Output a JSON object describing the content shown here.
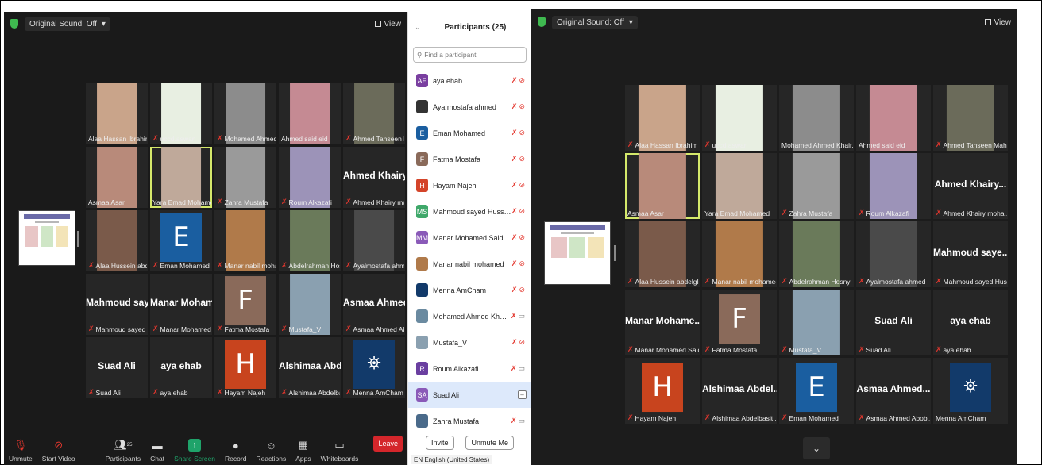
{
  "left": {
    "sound_label": "Original Sound: Off",
    "view_label": "View",
    "tiles": [
      {
        "name": "Alaa Hassan Ibrahim",
        "kind": "photo",
        "bg": "#c9a48a",
        "muted": false
      },
      {
        "name": "uccd.aswan",
        "kind": "photo",
        "bg": "#e8efe2",
        "muted": true
      },
      {
        "name": "Mohamed Ahmed Kh...",
        "kind": "photo",
        "bg": "#8c8c8c",
        "muted": true
      },
      {
        "name": "Ahmed said eid",
        "kind": "photo",
        "bg": "#c58a93",
        "muted": false
      },
      {
        "name": "Ahmed Tahseen Mah...",
        "kind": "photo",
        "bg": "#6b6b5a",
        "muted": true
      },
      {
        "name": "Asmaa Asar",
        "kind": "photo",
        "bg": "#b88a7a",
        "muted": false
      },
      {
        "name": "Yara Emad Mohamed",
        "kind": "photo",
        "bg": "#bfa99a",
        "muted": false,
        "active": true
      },
      {
        "name": "Zahra Mustafa",
        "kind": "photo",
        "bg": "#9a9a9a",
        "muted": true
      },
      {
        "name": "Roum Alkazafi",
        "kind": "photo",
        "bg": "#9c93b8",
        "muted": true
      },
      {
        "name": "Ahmed Khairy moha...",
        "kind": "text",
        "big": "Ahmed Khairy...",
        "muted": true
      },
      {
        "name": "Alaa Hussein abdelglil",
        "kind": "photo",
        "bg": "#7a5a4a",
        "muted": true
      },
      {
        "name": "Eman Mohamed",
        "kind": "letter",
        "letter": "E",
        "bg": "#1a5ea0",
        "muted": true
      },
      {
        "name": "Manar nabil mohamed",
        "kind": "photo",
        "bg": "#b07a4a",
        "muted": true
      },
      {
        "name": "Abdelrahman Hosny",
        "kind": "photo",
        "bg": "#6a7a5a",
        "muted": true
      },
      {
        "name": "Ayalmostafa ahmed",
        "kind": "photo",
        "bg": "#4a4a4a",
        "muted": true
      },
      {
        "name": "Mahmoud sayed Hus...",
        "kind": "text",
        "big": "Mahmoud saye...",
        "muted": true
      },
      {
        "name": "Manar Mohamed Said",
        "kind": "text",
        "big": "Manar Mohame...",
        "muted": true
      },
      {
        "name": "Fatma Mostafa",
        "kind": "letter",
        "letter": "F",
        "bg": "#8a6a5a",
        "muted": true
      },
      {
        "name": "Mustafa_V",
        "kind": "photo",
        "bg": "#8aa0b0",
        "muted": true
      },
      {
        "name": "Asmaa Ahmed Abob...",
        "kind": "text",
        "big": "Asmaa Ahmed...",
        "muted": true
      },
      {
        "name": "Suad Ali",
        "kind": "text",
        "big": "Suad Ali",
        "muted": true
      },
      {
        "name": "aya ehab",
        "kind": "text",
        "big": "aya ehab",
        "muted": true
      },
      {
        "name": "Hayam Najeh",
        "kind": "letter",
        "letter": "H",
        "bg": "#c8441e",
        "muted": true
      },
      {
        "name": "Alshimaa Abdelbasit ...",
        "kind": "text",
        "big": "Alshimaa Abdel...",
        "muted": true
      },
      {
        "name": "Menna AmCham",
        "kind": "logo",
        "bg": "#123a6a",
        "muted": true
      }
    ],
    "toolbar": {
      "unmute": "Unmute",
      "start_video": "Start Video",
      "participants": "Participants",
      "participants_count": "25",
      "chat": "Chat",
      "share": "Share Screen",
      "record": "Record",
      "reactions": "Reactions",
      "apps": "Apps",
      "whiteboards": "Whiteboards",
      "leave": "Leave"
    }
  },
  "panel": {
    "title": "Participants (25)",
    "search_placeholder": "Find a participant",
    "items": [
      {
        "name": "aya ehab",
        "avatar": "AE",
        "color": "#7a3fa0",
        "icons": "mic-off video-off"
      },
      {
        "name": "Aya mostafa ahmed",
        "avatar": "",
        "color": "#333333",
        "icons": "mic-off video-off"
      },
      {
        "name": "Eman Mohamed",
        "avatar": "E",
        "color": "#1a5ea0",
        "icons": "mic-off video-off"
      },
      {
        "name": "Fatma Mostafa",
        "avatar": "F",
        "color": "#8a6a5a",
        "icons": "mic-off video-off"
      },
      {
        "name": "Hayam Najeh",
        "avatar": "H",
        "color": "#d4442a",
        "icons": "mic-off video-off"
      },
      {
        "name": "Mahmoud sayed Hussein",
        "avatar": "MS",
        "color": "#3fa86a",
        "icons": "mic-off video-off"
      },
      {
        "name": "Manar Mohamed Said",
        "avatar": "MM",
        "color": "#8a5ab8",
        "icons": "mic-off video-off"
      },
      {
        "name": "Manar nabil mohamed",
        "avatar": "",
        "color": "#b07a4a",
        "icons": "mic-off video-off"
      },
      {
        "name": "Menna AmCham",
        "avatar": "",
        "color": "#123a6a",
        "icons": "mic-off video-off"
      },
      {
        "name": "Mohamed Ahmed Khairy Abdu...",
        "avatar": "",
        "color": "#6a8aa0",
        "icons": "mic-off video-on"
      },
      {
        "name": "Mustafa_V",
        "avatar": "",
        "color": "#8aa0b0",
        "icons": "mic-off video-off"
      },
      {
        "name": "Roum Alkazafi",
        "avatar": "R",
        "color": "#6a3fa0",
        "icons": "mic-off video-on"
      },
      {
        "name": "Suad Ali",
        "avatar": "SA",
        "color": "#8a5ab8",
        "icons": "host",
        "selected": true
      },
      {
        "name": "Zahra Mustafa",
        "avatar": "",
        "color": "#4a6a8a",
        "icons": "mic-off video-on"
      }
    ],
    "invite": "Invite",
    "unmute_me": "Unmute Me",
    "language": "EN English (United States)"
  },
  "right": {
    "sound_label": "Original Sound: Off",
    "view_label": "View",
    "tiles": [
      {
        "name": "Alaa Hassan Ibrahim",
        "kind": "photo",
        "bg": "#c9a48a",
        "muted": true
      },
      {
        "name": "uccd.aswan",
        "kind": "photo",
        "bg": "#e8efe2",
        "muted": true
      },
      {
        "name": "Mohamed Ahmed Khair...",
        "kind": "photo",
        "bg": "#8c8c8c",
        "muted": false
      },
      {
        "name": "Ahmed said eid",
        "kind": "photo",
        "bg": "#c58a93",
        "muted": false
      },
      {
        "name": "Ahmed Tahseen Mah...",
        "kind": "photo",
        "bg": "#6b6b5a",
        "muted": true
      },
      {
        "name": "Asmaa Asar",
        "kind": "photo",
        "bg": "#b88a7a",
        "muted": false,
        "active": true
      },
      {
        "name": "Yara Emad Mohamed",
        "kind": "photo",
        "bg": "#bfa99a",
        "muted": false
      },
      {
        "name": "Zahra Mustafa",
        "kind": "photo",
        "bg": "#9a9a9a",
        "muted": true
      },
      {
        "name": "Roum Alkazafi",
        "kind": "photo",
        "bg": "#9c93b8",
        "muted": true
      },
      {
        "name": "Ahmed Khairy moha...",
        "kind": "text",
        "big": "Ahmed Khairy...",
        "muted": true
      },
      {
        "name": "Alaa Hussein abdelglil",
        "kind": "photo",
        "bg": "#7a5a4a",
        "muted": true
      },
      {
        "name": "Manar nabil mohamed",
        "kind": "photo",
        "bg": "#b07a4a",
        "muted": true
      },
      {
        "name": "Abdelrahman Hosny",
        "kind": "photo",
        "bg": "#6a7a5a",
        "muted": true
      },
      {
        "name": "Ayalmostafa ahmed",
        "kind": "photo",
        "bg": "#4a4a4a",
        "muted": true
      },
      {
        "name": "Mahmoud sayed Hus...",
        "kind": "text",
        "big": "Mahmoud saye...",
        "muted": true
      },
      {
        "name": "Manar Mohamed Said",
        "kind": "text",
        "big": "Manar Mohame...",
        "muted": true
      },
      {
        "name": "Fatma Mostafa",
        "kind": "letter",
        "letter": "F",
        "bg": "#8a6a5a",
        "muted": true
      },
      {
        "name": "Mustafa_V",
        "kind": "photo",
        "bg": "#8aa0b0",
        "muted": true
      },
      {
        "name": "Suad Ali",
        "kind": "text",
        "big": "Suad Ali",
        "muted": true
      },
      {
        "name": "aya ehab",
        "kind": "text",
        "big": "aya ehab",
        "muted": true
      },
      {
        "name": "Hayam Najeh",
        "kind": "letter",
        "letter": "H",
        "bg": "#c8441e",
        "muted": true
      },
      {
        "name": "Alshimaa Abdelbasit ...",
        "kind": "text",
        "big": "Alshimaa Abdel...",
        "muted": true
      },
      {
        "name": "Eman Mohamed",
        "kind": "letter",
        "letter": "E",
        "bg": "#1a5ea0",
        "muted": true
      },
      {
        "name": "Asmaa Ahmed Abob...",
        "kind": "text",
        "big": "Asmaa Ahmed...",
        "muted": true
      },
      {
        "name": "Menna AmCham",
        "kind": "logo",
        "bg": "#123a6a",
        "muted": false
      }
    ]
  },
  "colors": {
    "accent_green": "#1fa36a",
    "leave_red": "#d4262b",
    "active_speaker": "#d4e86a",
    "mic_off": "#e3372e"
  }
}
